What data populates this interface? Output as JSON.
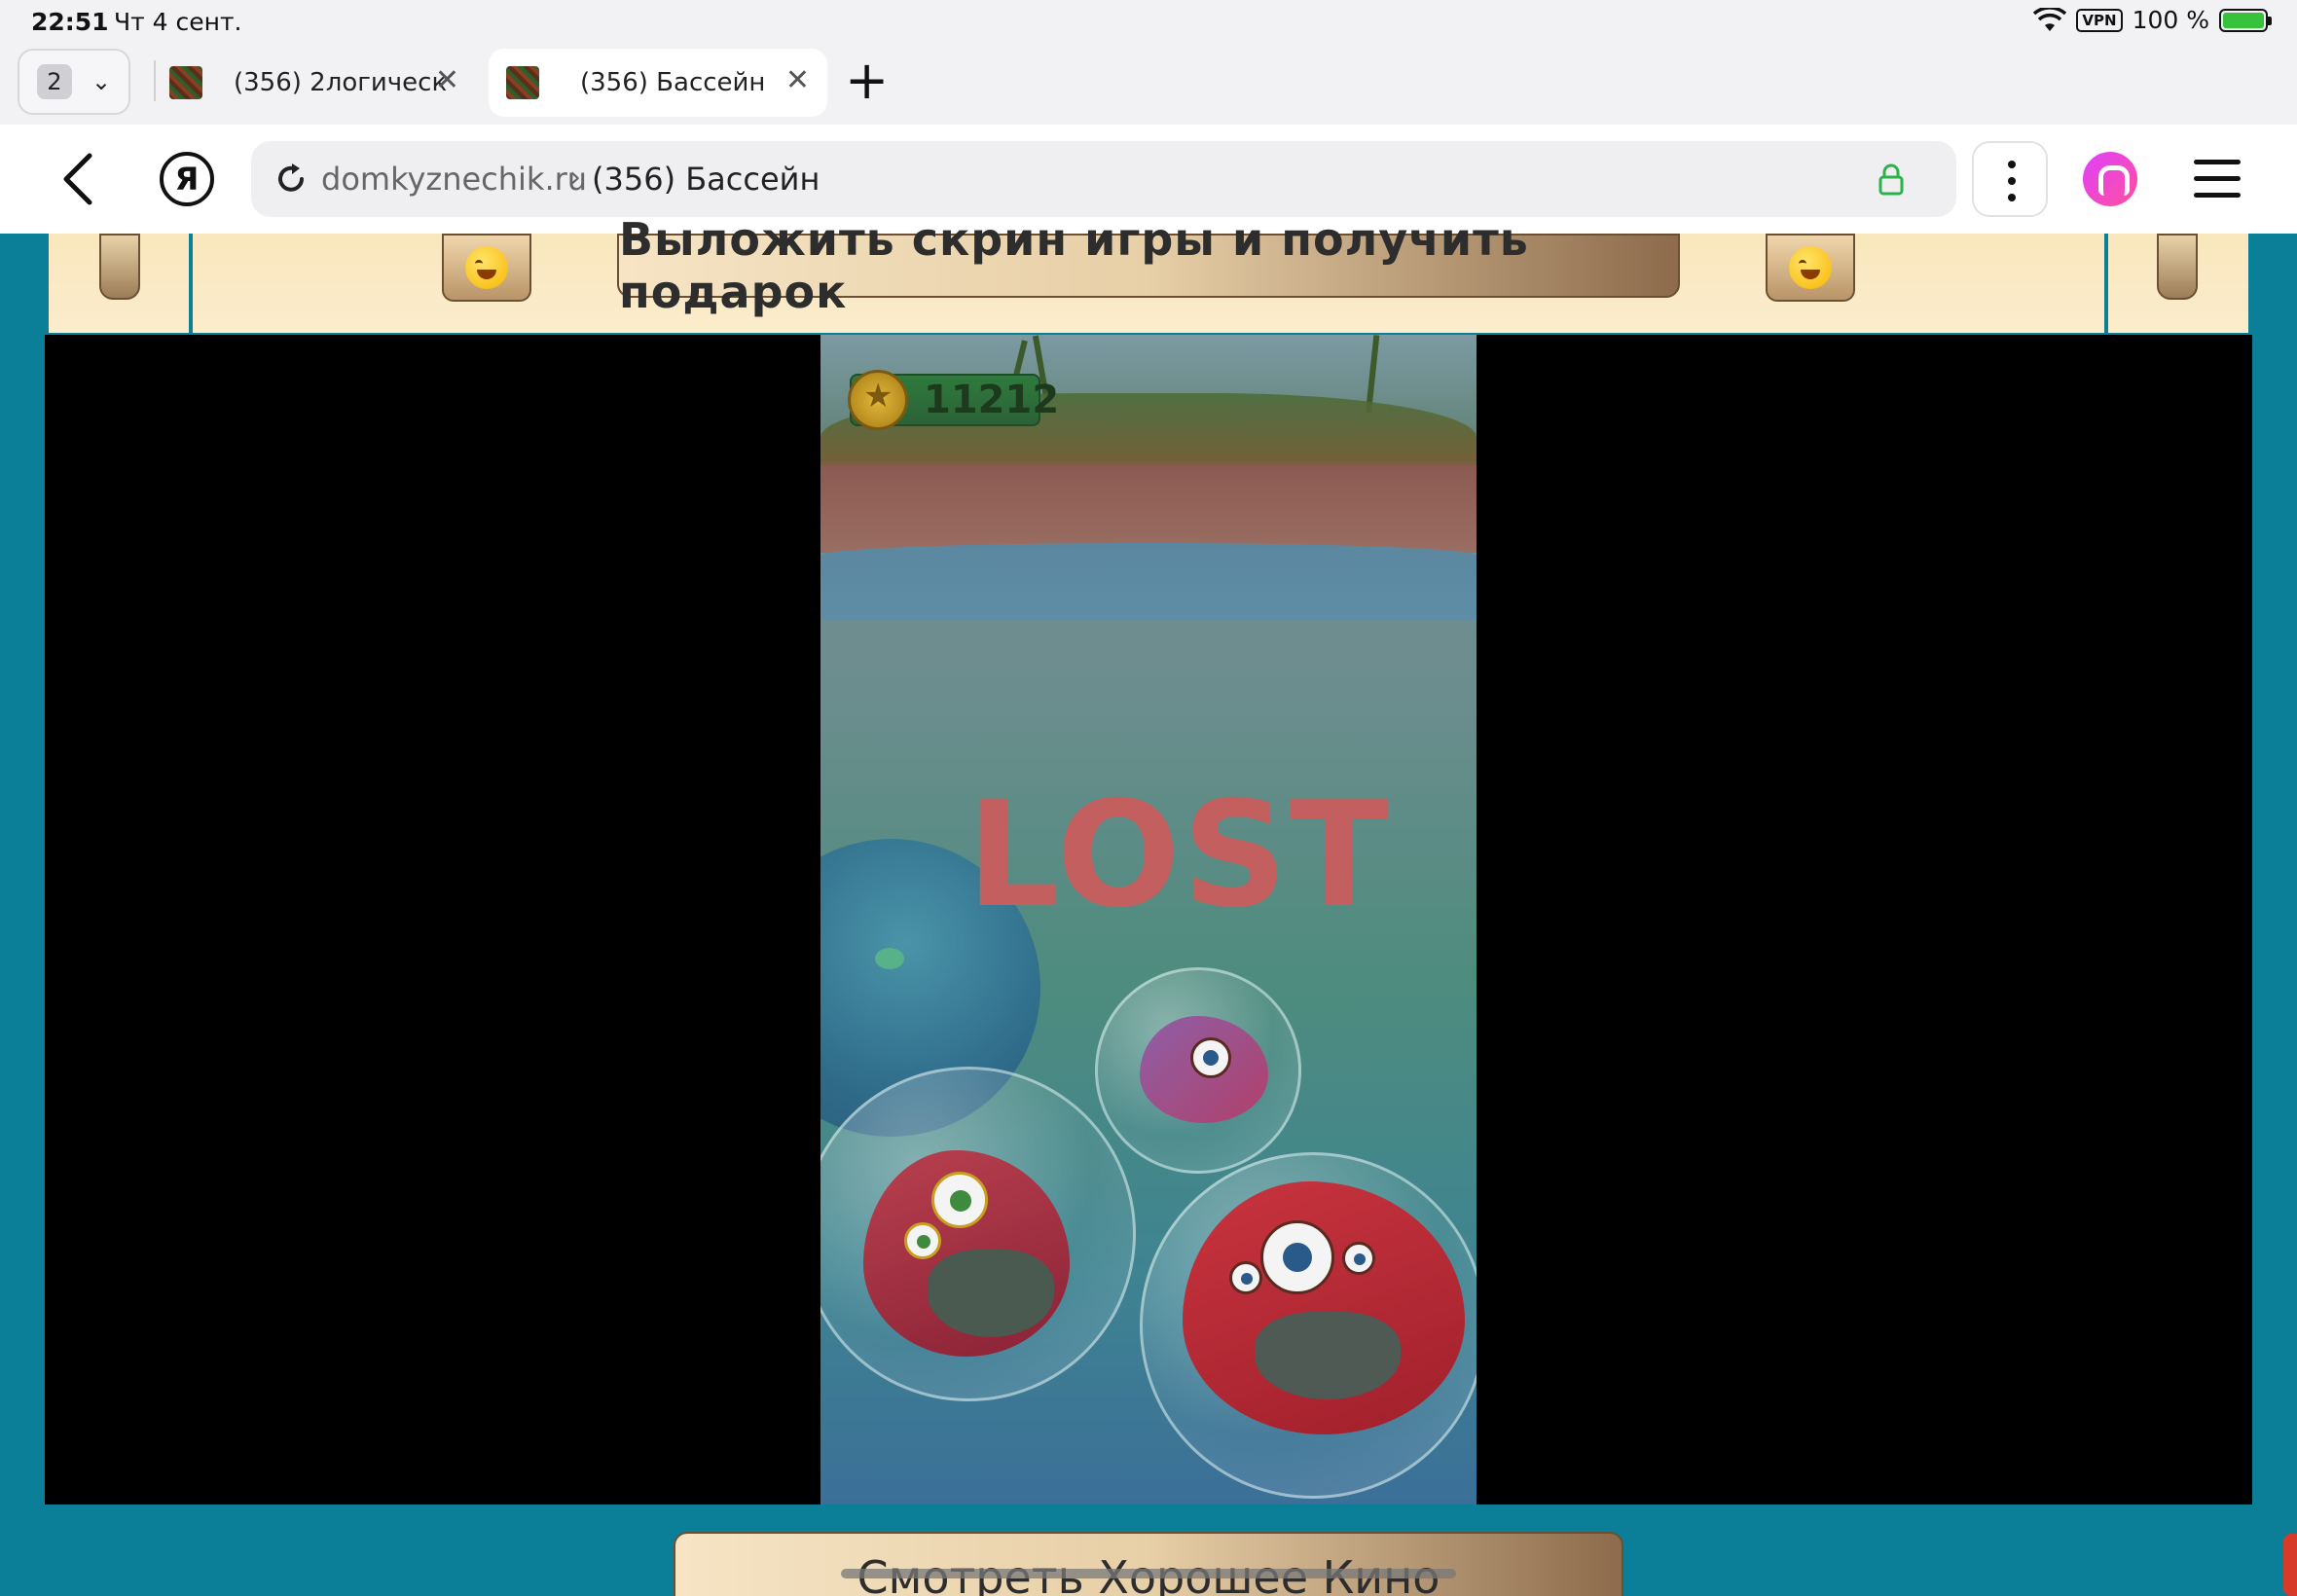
{
  "status": {
    "time": "22:51",
    "date": "Чт 4 сент.",
    "vpn": "VPN",
    "battery": "100 %"
  },
  "tabs": {
    "count": "2",
    "items": [
      {
        "title": "(356) 2логическ..."
      },
      {
        "title": "(356) Бассейн"
      }
    ]
  },
  "address": {
    "domain": "domkyznechik.ru",
    "separator": "›",
    "page_title": "(356) Бассейн"
  },
  "yandex_letter": "Я",
  "banner": {
    "post_label": "Выложить скрин игры и получить подарок"
  },
  "game": {
    "coins": "11212",
    "status": "LOST"
  },
  "footer": {
    "cinema_label": "Смотреть Хорошее Кино"
  },
  "colors": {
    "page_bg": "#0b7f98",
    "banner_bg": "#f9e7bd",
    "lost": "#c45f60"
  }
}
